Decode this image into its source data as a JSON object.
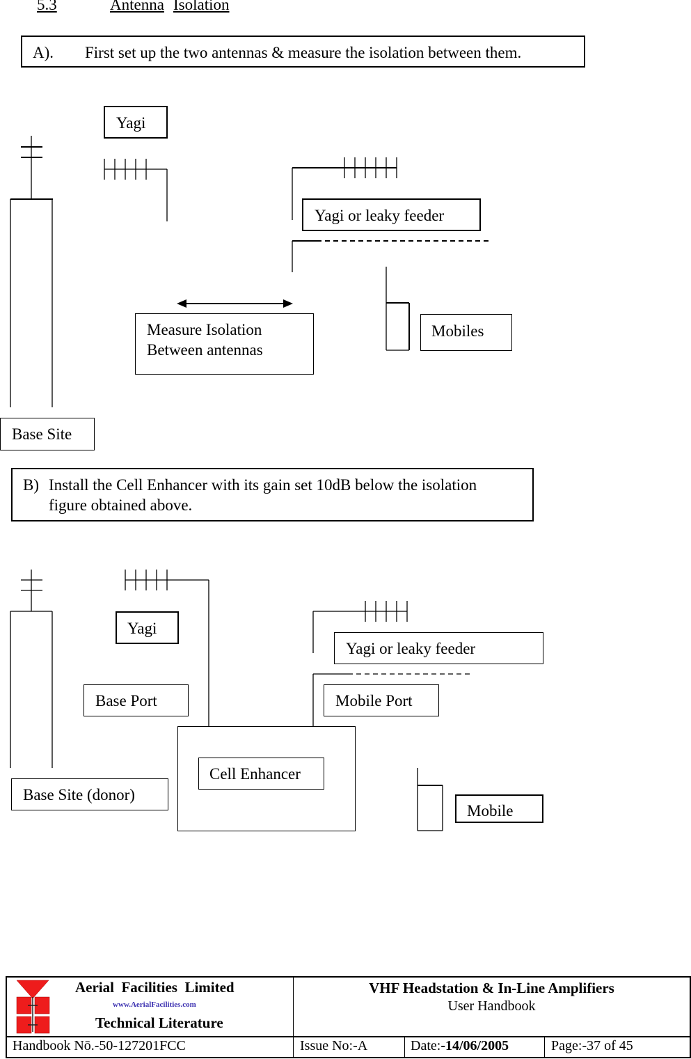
{
  "section": {
    "number": "5.3",
    "title_word1": "Antenna",
    "title_word2": "Isolation"
  },
  "step_a": {
    "label": "A).",
    "text": "First set up the two antennas & measure the isolation between them."
  },
  "diagram_a": {
    "yagi": "Yagi",
    "yagi_or_leaky": "Yagi or leaky feeder",
    "measure_line1": "Measure Isolation",
    "measure_line2": "Between antennas",
    "mobiles": "Mobiles",
    "base_site": "Base Site"
  },
  "step_b": {
    "label": "B)",
    "line1": "Install the Cell Enhancer with its gain set 10dB below the isolation",
    "line2": "figure obtained above."
  },
  "diagram_b": {
    "yagi": "Yagi",
    "yagi_or_leaky": "Yagi or leaky feeder",
    "base_port": "Base Port",
    "mobile_port": "Mobile Port",
    "cell_enhancer": "Cell Enhancer",
    "base_site_donor": "Base Site (donor)",
    "mobile": "Mobile"
  },
  "footer": {
    "company": "Aerial  Facilities  Limited",
    "website": "www.AerialFacilities.com",
    "literature": "Technical Literature",
    "product": "VHF Headstation & In-Line Amplifiers",
    "doc_type": "User Handbook",
    "handbook": "Handbook Nō.-50-127201FCC",
    "issue": "Issue No:-A",
    "date_label": "Date:",
    "date_value": "-14/06/2005",
    "page_label": "Page:",
    "page_value": "-37 of 45",
    "colors": {
      "logo_red": "#ee1c1c",
      "website_blue": "#3a2fb0"
    }
  }
}
